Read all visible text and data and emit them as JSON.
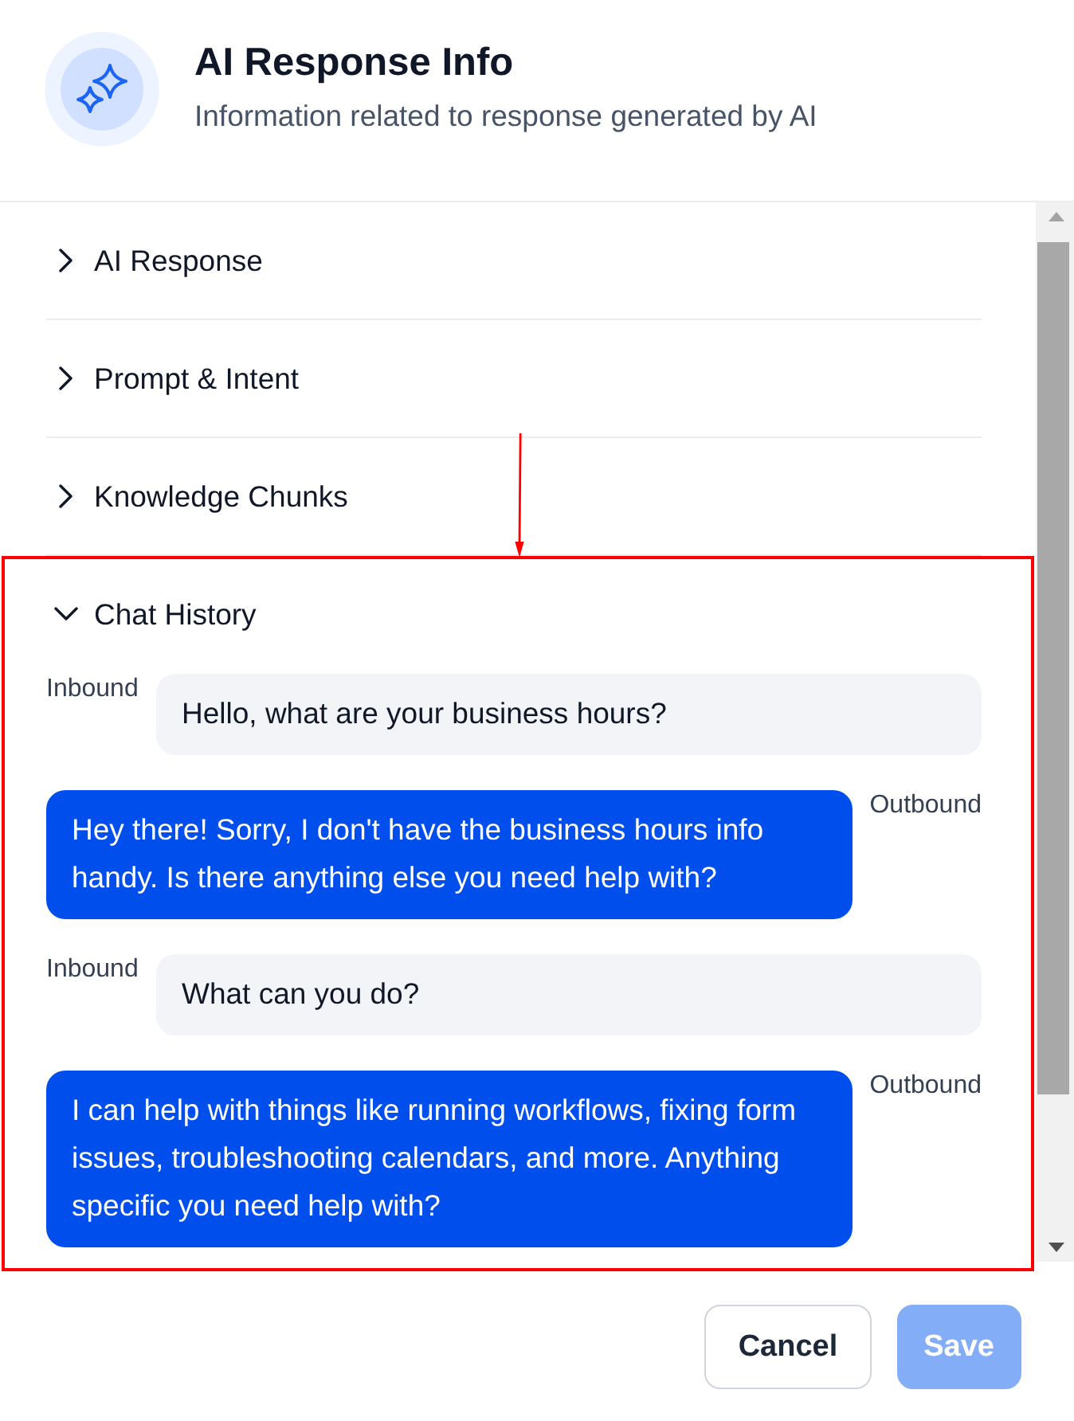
{
  "header": {
    "title": "AI Response Info",
    "subtitle": "Information related to response generated by AI"
  },
  "sections": [
    {
      "title": "AI Response",
      "expanded": false,
      "highlighted": false
    },
    {
      "title": "Prompt & Intent",
      "expanded": false,
      "highlighted": false
    },
    {
      "title": "Knowledge Chunks",
      "expanded": false,
      "highlighted": false
    },
    {
      "title": "Chat History",
      "expanded": true,
      "highlighted": true,
      "messages": [
        {
          "kind": "inbound",
          "label": "Inbound",
          "text": "Hello, what are your business hours?"
        },
        {
          "kind": "outbound",
          "label": "Outbound",
          "text": "Hey there! Sorry, I don't have the business hours info handy. Is there anything else you need help with?"
        },
        {
          "kind": "inbound",
          "label": "Inbound",
          "text": "What can you do?"
        },
        {
          "kind": "outbound",
          "label": "Outbound",
          "text": "I can help with things like running workflows, fixing form issues, troubleshooting calendars, and more. Anything specific you need help with?"
        }
      ]
    }
  ],
  "buttons": [
    {
      "kind": "outline",
      "label": "Cancel",
      "disabled": false
    },
    {
      "kind": "primary",
      "label": "Save",
      "disabled": true
    }
  ]
}
